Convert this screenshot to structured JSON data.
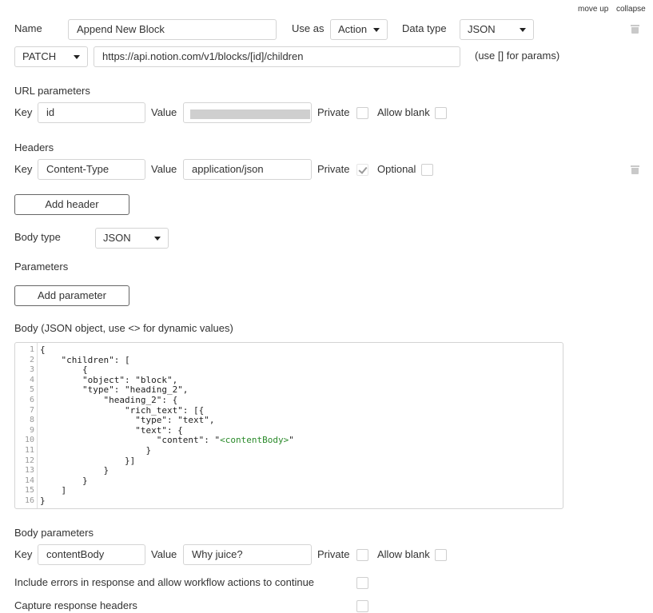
{
  "top_links": {
    "move_up": "move up",
    "collapse": "collapse"
  },
  "call": {
    "name_label": "Name",
    "name_value": "Append New Block",
    "use_as_label": "Use as",
    "use_as_value": "Action",
    "data_type_label": "Data type",
    "data_type_value": "JSON",
    "method_value": "PATCH",
    "url_value": "https://api.notion.com/v1/blocks/[id]/children",
    "url_hint": "(use [] for params)"
  },
  "url_parameters": {
    "title": "URL parameters",
    "key_label": "Key",
    "key_value": "id",
    "value_label": "Value",
    "private_label": "Private",
    "private_checked": false,
    "allow_blank_label": "Allow blank",
    "allow_blank_checked": false
  },
  "headers": {
    "title": "Headers",
    "key_label": "Key",
    "key_value": "Content-Type",
    "value_label": "Value",
    "value_value": "application/json",
    "private_label": "Private",
    "private_checked": true,
    "optional_label": "Optional",
    "optional_checked": false,
    "add_button": "Add header"
  },
  "body_type": {
    "label": "Body type",
    "value": "JSON"
  },
  "parameters": {
    "title": "Parameters",
    "add_button": "Add parameter"
  },
  "body": {
    "title": "Body (JSON object, use <> for dynamic values)",
    "line_numbers": [
      "1",
      "2",
      "3",
      "4",
      "5",
      "6",
      "7",
      "8",
      "9",
      "10",
      "11",
      "12",
      "13",
      "14",
      "15",
      "16"
    ],
    "lines": [
      "{",
      "    \"children\": [",
      "        {",
      "        \"object\": \"block\",",
      "        \"type\": \"heading_2\",",
      "            \"heading_2\": {",
      "                \"rich_text\": [{",
      "                  \"type\": \"text\",",
      "                  \"text\": {",
      "                      \"content\": \"",
      "                    }",
      "                }]",
      "            }",
      "        }",
      "    ]",
      "}"
    ],
    "dynamic_value": "<contentBody>",
    "line10_end": "\""
  },
  "body_parameters": {
    "title": "Body parameters",
    "key_label": "Key",
    "key_value": "contentBody",
    "value_label": "Value",
    "value_value": "Why juice?",
    "private_label": "Private",
    "private_checked": false,
    "allow_blank_label": "Allow blank",
    "allow_blank_checked": false
  },
  "options": {
    "include_errors_label": "Include errors in response and allow workflow actions to continue",
    "include_errors_checked": false,
    "capture_headers_label": "Capture response headers",
    "capture_headers_checked": false
  },
  "icons": {
    "delete": "trash-icon",
    "dropdown": "chevron-down-icon",
    "check": "check-icon"
  }
}
